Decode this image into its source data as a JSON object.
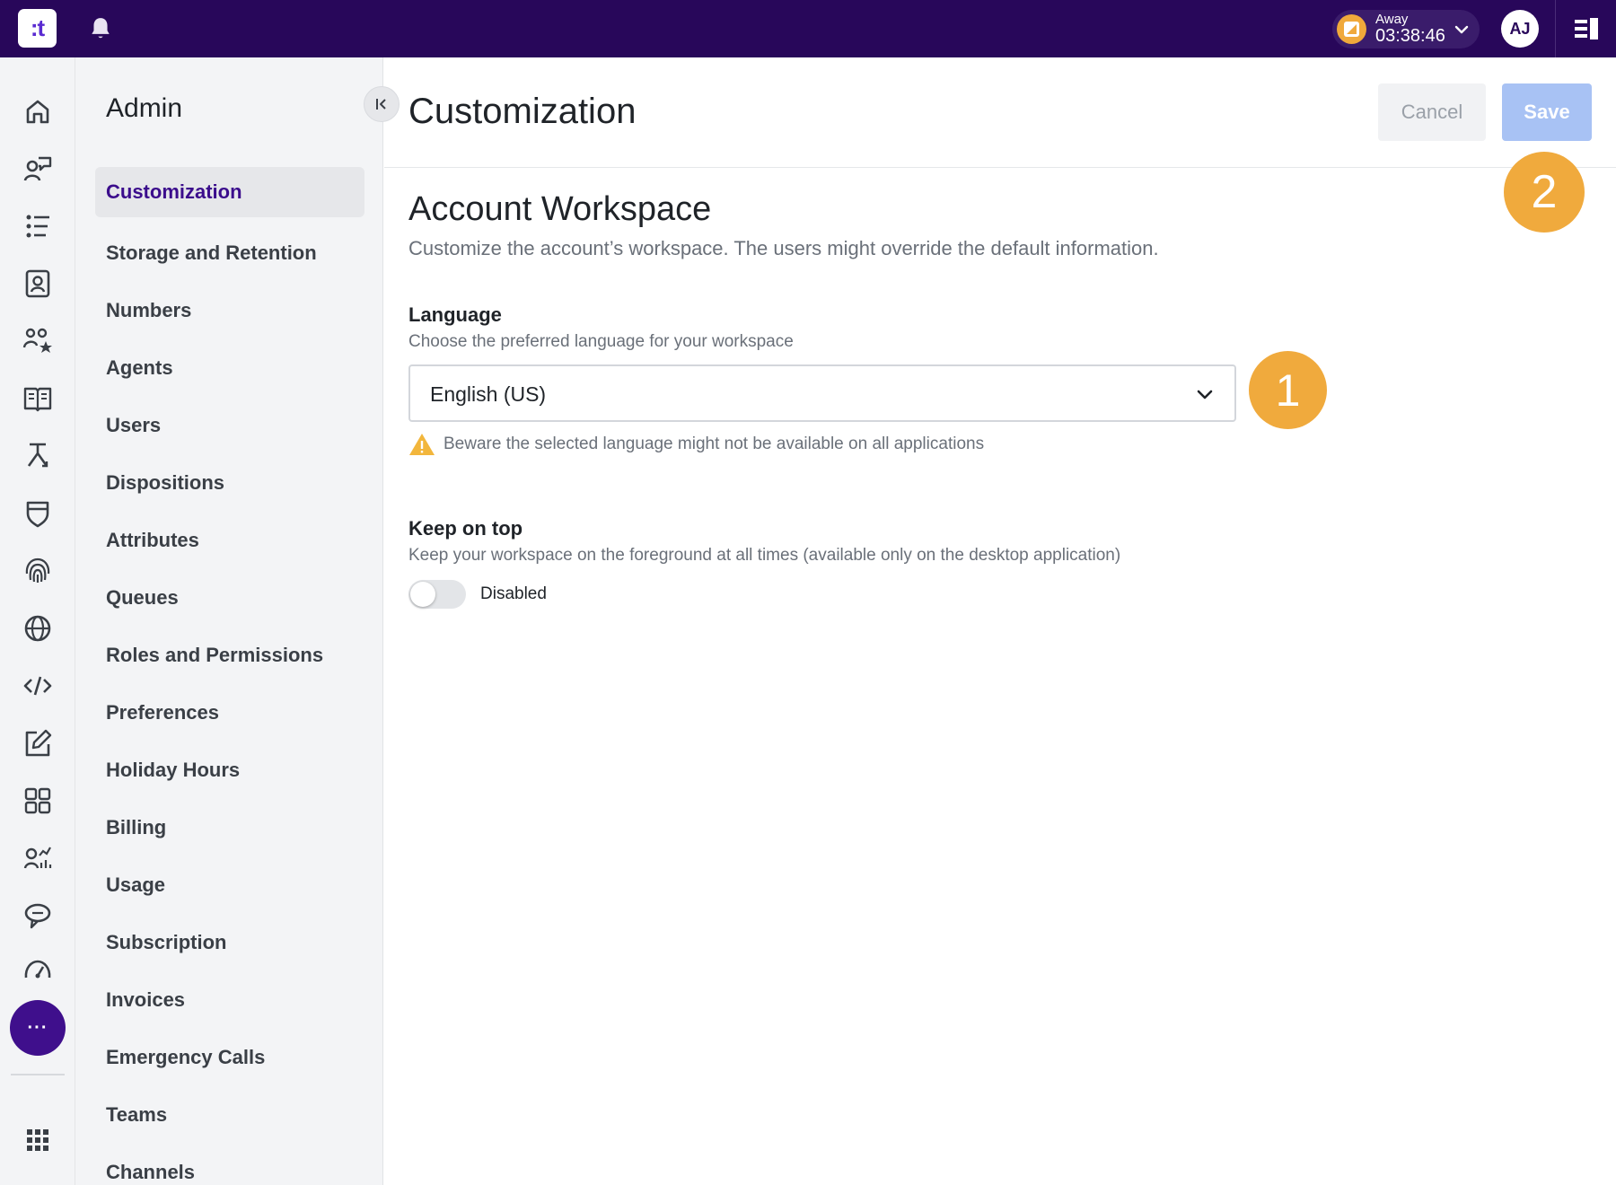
{
  "topbar": {
    "logo_text": ":t",
    "status": {
      "label": "Away",
      "time": "03:38:46",
      "color": "#f0aa3d"
    },
    "avatar_initials": "AJ",
    "background": "#28075a"
  },
  "rail": {
    "icons": [
      "home-icon",
      "conversations-icon",
      "list-icon",
      "contacts-icon",
      "teams-icon",
      "knowledge-book-icon",
      "routing-icon",
      "shield-icon",
      "fingerprint-icon",
      "globe-icon",
      "code-icon",
      "edit-icon",
      "dashboard-grid-icon",
      "analytics-icon",
      "chat-bubble-icon",
      "speedometer-icon",
      "more-icon",
      "app-grid-icon"
    ],
    "more_label": "···"
  },
  "nav": {
    "title": "Admin",
    "items": [
      {
        "label": "Customization",
        "active": true
      },
      {
        "label": "Storage and Retention"
      },
      {
        "label": "Numbers"
      },
      {
        "label": "Agents"
      },
      {
        "label": "Users"
      },
      {
        "label": "Dispositions"
      },
      {
        "label": "Attributes"
      },
      {
        "label": "Queues"
      },
      {
        "label": "Roles and Permissions"
      },
      {
        "label": "Preferences"
      },
      {
        "label": "Holiday Hours"
      },
      {
        "label": "Billing"
      },
      {
        "label": "Usage"
      },
      {
        "label": "Subscription"
      },
      {
        "label": "Invoices"
      },
      {
        "label": "Emergency Calls"
      },
      {
        "label": "Teams"
      },
      {
        "label": "Channels"
      }
    ]
  },
  "main": {
    "title": "Customization",
    "cancel_label": "Cancel",
    "save_label": "Save",
    "markers": {
      "one": "1",
      "two": "2"
    },
    "section": {
      "title": "Account Workspace",
      "description": "Customize the account’s workspace. The users might override the default information."
    },
    "language": {
      "label": "Language",
      "help": "Choose the preferred language for your workspace",
      "value": "English (US)",
      "warning": "Beware the selected language might not be available on all applications"
    },
    "keep_on_top": {
      "label": "Keep on top",
      "help": "Keep your workspace on the foreground at all times (available only on the desktop application)",
      "state_label": "Disabled",
      "enabled": false
    }
  },
  "colors": {
    "accent": "#3b0d8c",
    "save_disabled": "#a8c2f4",
    "marker": "#f0aa3d",
    "warning": "#f2b63c"
  }
}
